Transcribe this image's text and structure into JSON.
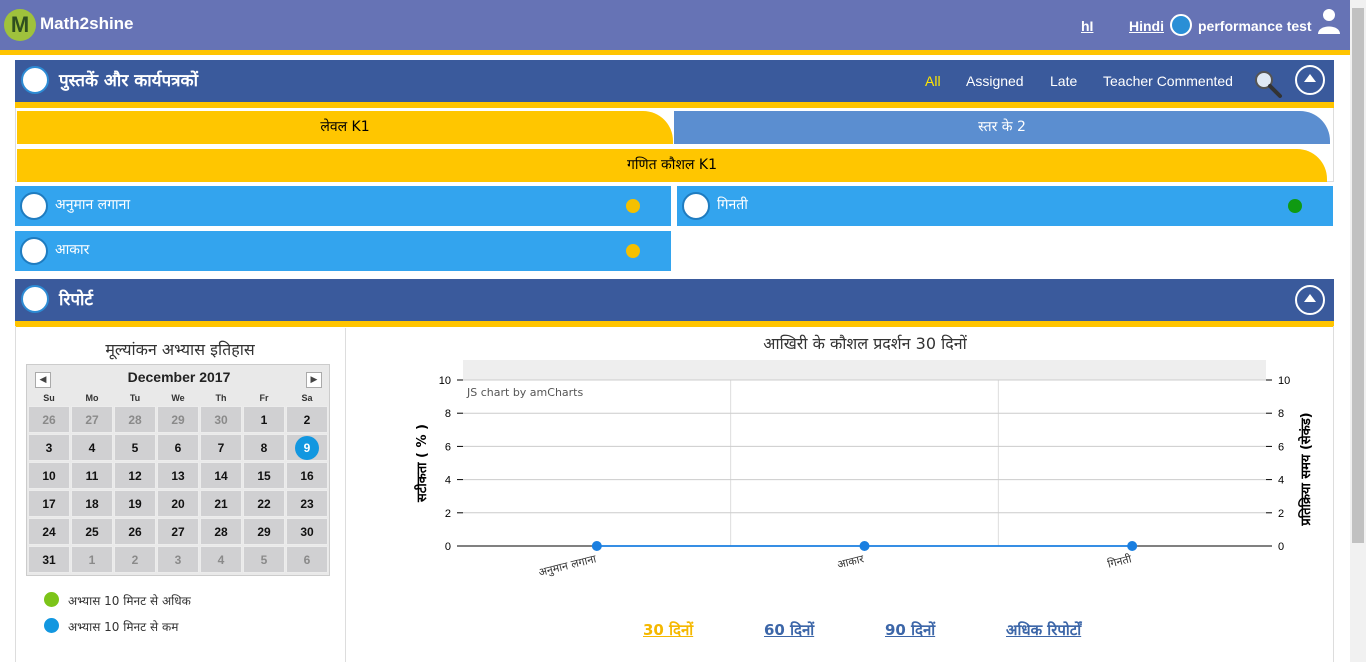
{
  "header": {
    "app_title": "Math2shine",
    "logo_letter": "M",
    "lang_code": "hI",
    "lang_name": "Hindi",
    "user_name": "performance test"
  },
  "books": {
    "title": "पुस्तकें और कार्यपत्रकों",
    "filters": [
      "All",
      "Assigned",
      "Late",
      "Teacher Commented"
    ],
    "active_filter": "All",
    "level_tabs": [
      {
        "label": "लेवल K1",
        "active": true
      },
      {
        "label": "स्तर के 2",
        "active": false
      }
    ],
    "skill_tab": "गणित कौशल K1",
    "items": [
      {
        "label": "अनुमान लगाना",
        "status_color": "#f5c000"
      },
      {
        "label": "गिनती",
        "status_color": "#0f9a12"
      },
      {
        "label": "आकार",
        "status_color": "#f5c000"
      }
    ]
  },
  "report": {
    "title": "रिपोर्ट",
    "calendar": {
      "title": "मूल्यांकन अभ्यास इतिहास",
      "month": "December 2017",
      "prev": "◀",
      "next": "▶",
      "weekdays": [
        "Su",
        "Mo",
        "Tu",
        "We",
        "Th",
        "Fr",
        "Sa"
      ],
      "weeks": [
        [
          "26",
          "27",
          "28",
          "29",
          "30",
          "1",
          "2"
        ],
        [
          "3",
          "4",
          "5",
          "6",
          "7",
          "8",
          "9"
        ],
        [
          "10",
          "11",
          "12",
          "13",
          "14",
          "15",
          "16"
        ],
        [
          "17",
          "18",
          "19",
          "20",
          "21",
          "22",
          "23"
        ],
        [
          "24",
          "25",
          "26",
          "27",
          "28",
          "29",
          "30"
        ],
        [
          "31",
          "1",
          "2",
          "3",
          "4",
          "5",
          "6"
        ]
      ],
      "outside_month": [
        [
          0,
          0
        ],
        [
          0,
          1
        ],
        [
          0,
          2
        ],
        [
          0,
          3
        ],
        [
          0,
          4
        ],
        [
          5,
          1
        ],
        [
          5,
          2
        ],
        [
          5,
          3
        ],
        [
          5,
          4
        ],
        [
          5,
          5
        ],
        [
          5,
          6
        ]
      ],
      "today": "9",
      "legend": [
        {
          "label": "अभ्यास 10 मिनट से अधिक",
          "color": "#7cc419"
        },
        {
          "label": "अभ्यास 10 मिनट से कम",
          "color": "#1297e0"
        }
      ]
    },
    "ranges": [
      "30 दिनों",
      "60 दिनों",
      "90 दिनों",
      "अधिक रिपोर्टों"
    ],
    "active_range": "30 दिनों"
  },
  "chart_data": {
    "type": "line",
    "title": "आखिरी के कौशल प्रदर्शन 30 दिनों",
    "categories": [
      "अनुमान लगाना",
      "आकार",
      "गिनती"
    ],
    "series": [
      {
        "axis": "left",
        "values": [
          0,
          0,
          0
        ],
        "color": "#1a7fe0"
      },
      {
        "axis": "right",
        "values": [
          0,
          0,
          0
        ],
        "color": "#1a7fe0"
      }
    ],
    "ylabel": "सटीकता ( % )",
    "ylabel_right": "प्रतिक्रिया समय (सेकंड)",
    "ylim": [
      0,
      10
    ],
    "yticks": [
      0,
      2,
      4,
      6,
      8,
      10
    ],
    "grid": true,
    "watermark": "JS chart by amCharts"
  }
}
